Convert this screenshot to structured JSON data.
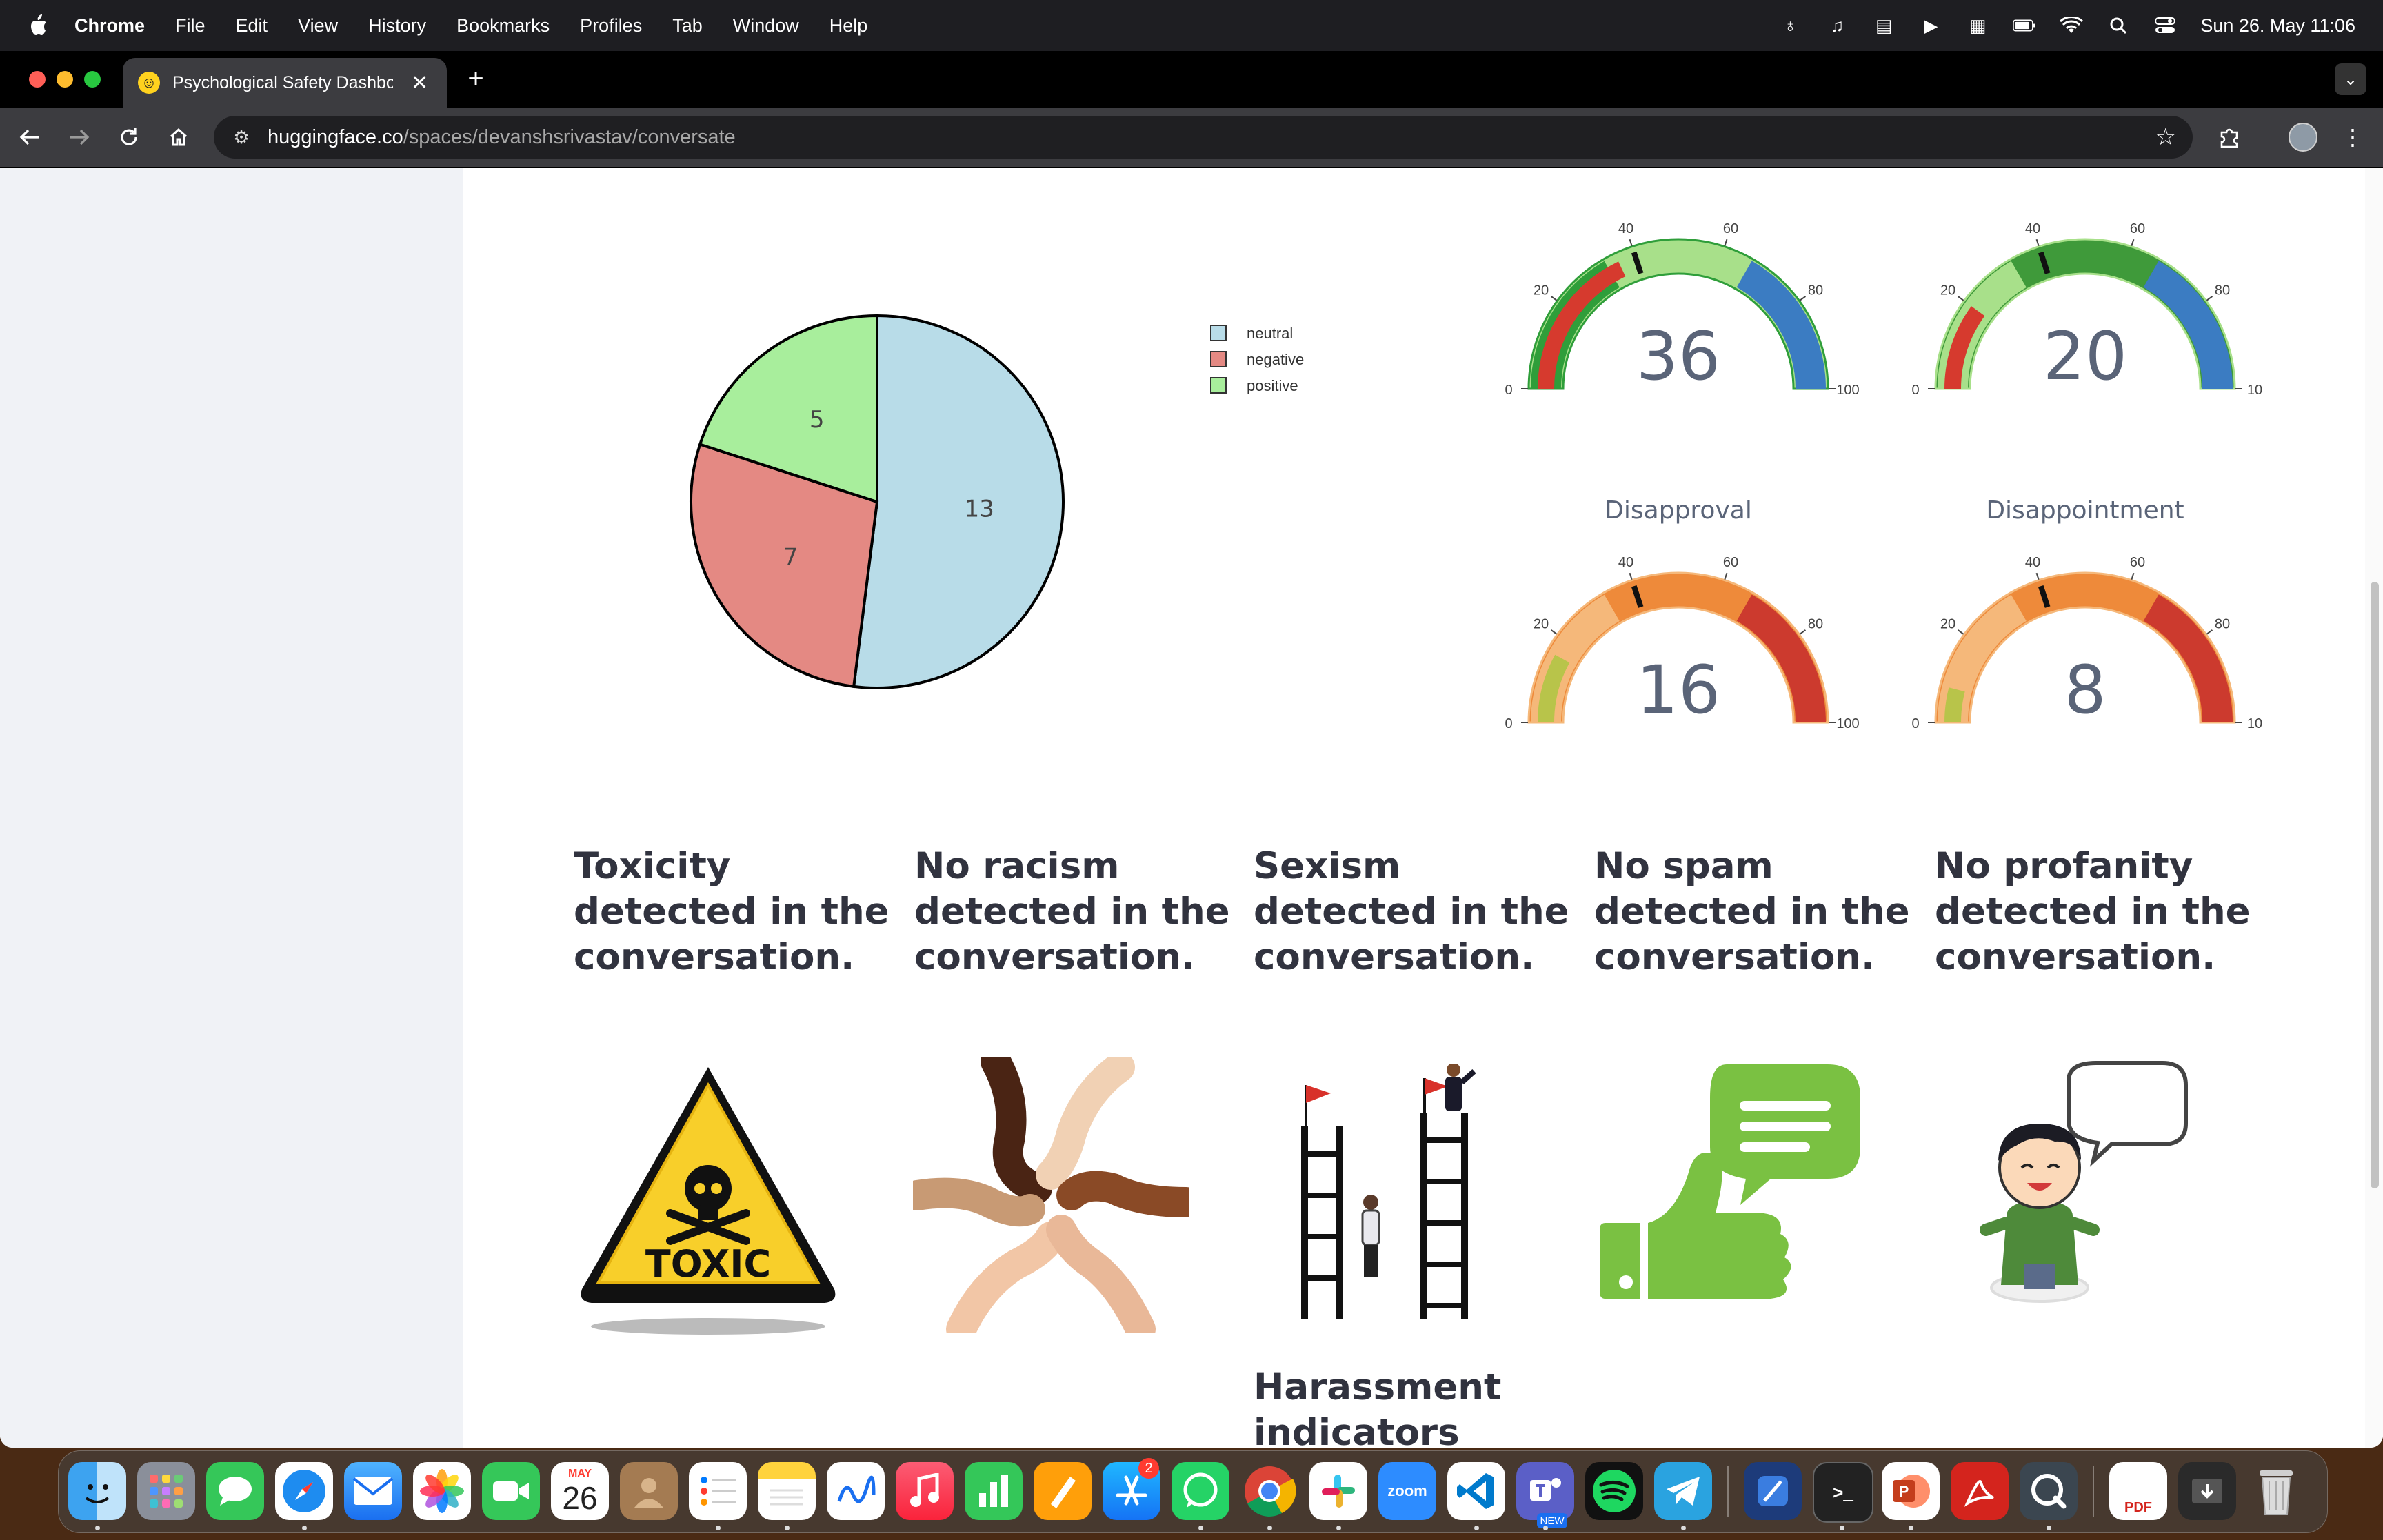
{
  "menubar": {
    "app_name": "Chrome",
    "items": [
      "File",
      "Edit",
      "View",
      "History",
      "Bookmarks",
      "Profiles",
      "Tab",
      "Window",
      "Help"
    ],
    "clock": "Sun 26. May  11:06"
  },
  "browser": {
    "tab_title": "Psychological Safety Dashboard",
    "url_host": "huggingface.co",
    "url_path": "/spaces/devanshsrivastav/conversate"
  },
  "pie": {
    "legend": [
      "neutral",
      "negative",
      "positive"
    ],
    "colors": {
      "neutral": "#b8dce8",
      "negative": "#e48983",
      "positive": "#a8ee9c"
    },
    "chart_data": {
      "type": "pie",
      "categories": [
        "neutral",
        "negative",
        "positive"
      ],
      "values": [
        13,
        7,
        5
      ]
    }
  },
  "gauges": [
    {
      "title": "",
      "value": 36,
      "threshold": 40,
      "ticks": [
        "0",
        "20",
        "40",
        "60",
        "80",
        "100"
      ],
      "colors": [
        "#2f9e3a",
        "#a8e08a",
        "#3b7cc2"
      ],
      "bar_color": "#d63a2e"
    },
    {
      "title": "",
      "value": 20,
      "threshold": 40,
      "ticks": [
        "0",
        "20",
        "40",
        "60",
        "80",
        "10"
      ],
      "colors": [
        "#a8e08a",
        "#3f9a3a",
        "#3b7cc2"
      ],
      "bar_color": "#d63a2e"
    },
    {
      "title": "Disapproval",
      "value": 16,
      "threshold": 40,
      "ticks": [
        "0",
        "20",
        "40",
        "60",
        "80",
        "100"
      ],
      "colors": [
        "#f5b87a",
        "#ee8a3a",
        "#cc3a2e"
      ],
      "bar_color": "#b8c44a"
    },
    {
      "title": "Disappointment",
      "value": 8,
      "threshold": 40,
      "ticks": [
        "0",
        "20",
        "40",
        "60",
        "80",
        "10"
      ],
      "colors": [
        "#f5b87a",
        "#ee8a3a",
        "#cc3a2e"
      ],
      "bar_color": "#b8c44a"
    }
  ],
  "cards": [
    {
      "label": "Toxicity detected in the conversation.",
      "icon": "toxic-warning-sign",
      "sign_text": "TOXIC"
    },
    {
      "label": "No racism detected in the conversation.",
      "icon": "hands-circle"
    },
    {
      "label": "Sexism detected in the conversation.",
      "icon": "ladders-inequality"
    },
    {
      "label": "No spam detected in the conversation.",
      "icon": "thumbs-up-message"
    },
    {
      "label": "No profanity detected in the conversation.",
      "icon": "boy-speech-bubble"
    }
  ],
  "harassment_label": "Harassment indicators detected",
  "dock": {
    "calendar_month": "MAY",
    "calendar_day": "26",
    "appstore_badge": "2",
    "zoom_label": "zoom",
    "teams_label": "NEW",
    "pdf_label": "PDF"
  }
}
